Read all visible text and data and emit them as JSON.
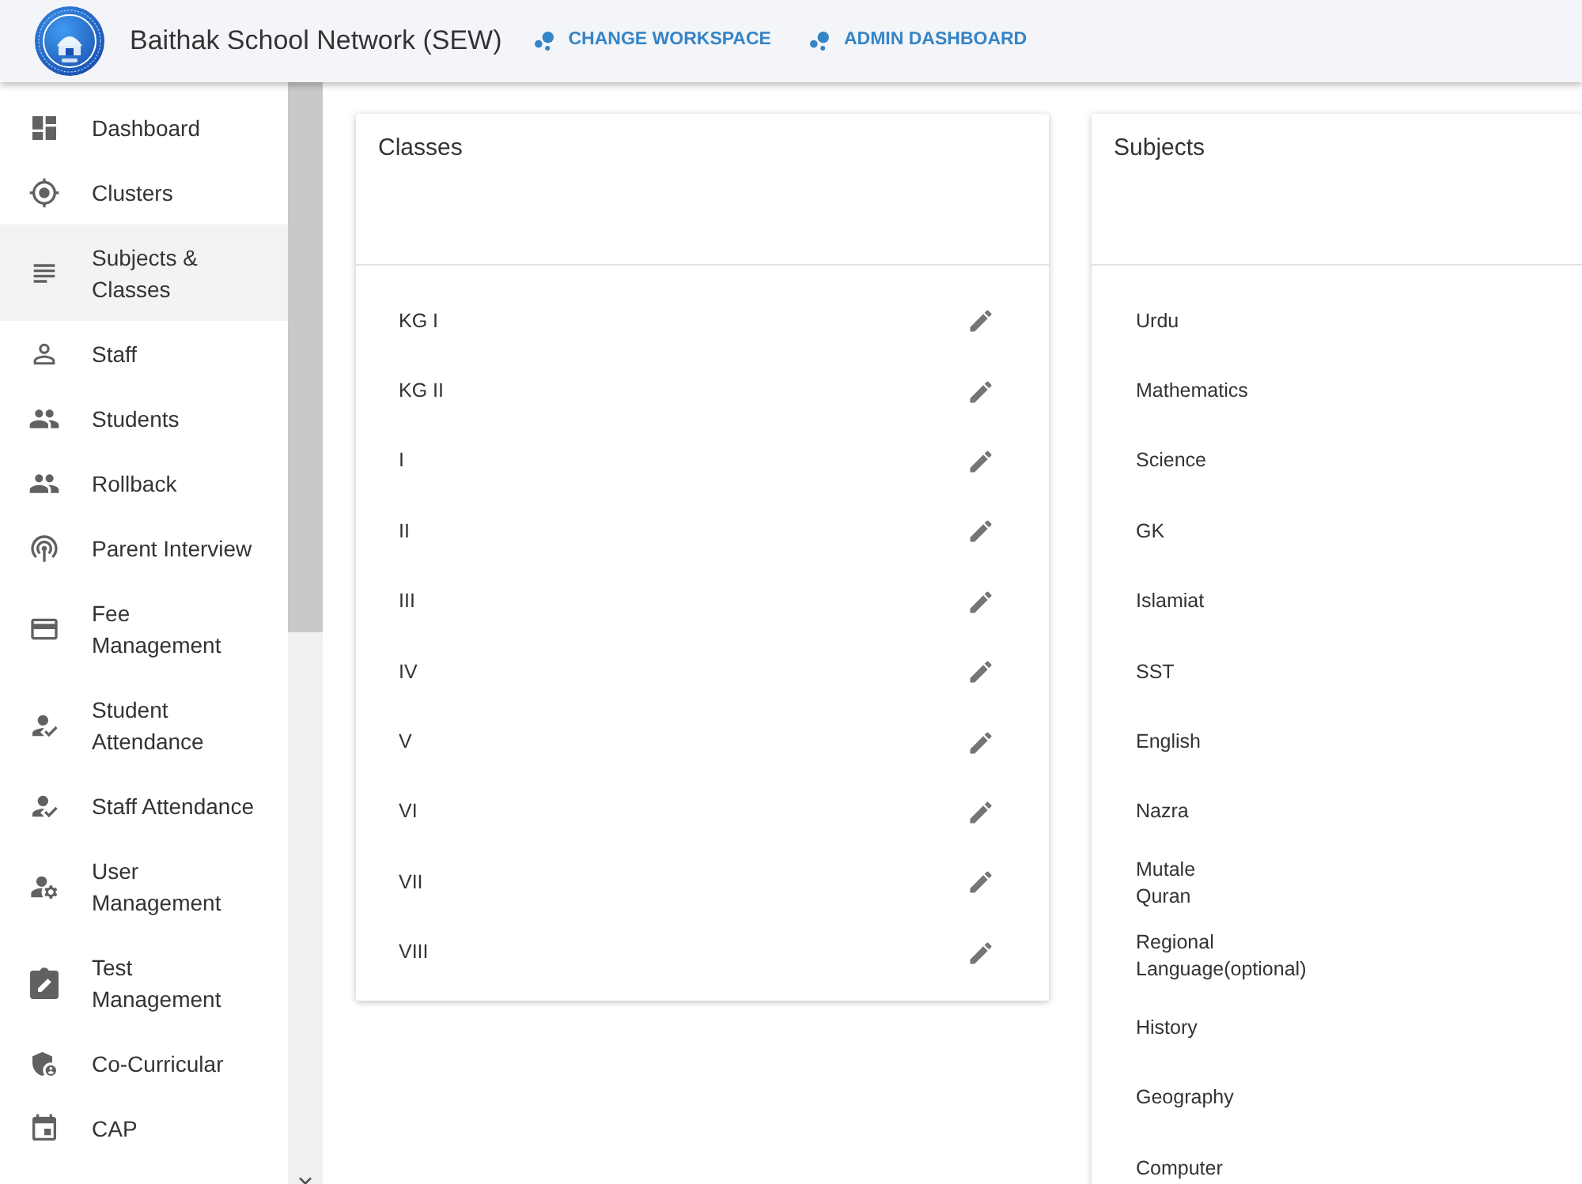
{
  "header": {
    "title": "Baithak School Network (SEW)",
    "nav_links": [
      "CHANGE WORKSPACE",
      "ADMIN DASHBOARD"
    ]
  },
  "sidebar": {
    "items": [
      {
        "label": "Dashboard",
        "selected": false
      },
      {
        "label": "Clusters",
        "selected": false
      },
      {
        "label": "Subjects & Classes",
        "selected": true
      },
      {
        "label": "Staff",
        "selected": false
      },
      {
        "label": "Students",
        "selected": false
      },
      {
        "label": "Rollback",
        "selected": false
      },
      {
        "label": "Parent Interview",
        "selected": false
      },
      {
        "label": "Fee Management",
        "selected": false
      },
      {
        "label": "Student Attendance",
        "selected": false
      },
      {
        "label": "Staff Attendance",
        "selected": false
      },
      {
        "label": "User Management",
        "selected": false
      },
      {
        "label": "Test Management",
        "selected": false
      },
      {
        "label": "Co-Curricular",
        "selected": false
      },
      {
        "label": "CAP",
        "selected": false
      }
    ]
  },
  "classes_card": {
    "title": "Classes",
    "rows": [
      "KG I",
      "KG II",
      "I",
      "II",
      "III",
      "IV",
      "V",
      "VI",
      "VII",
      "VIII"
    ]
  },
  "subjects_card": {
    "title": "Subjects",
    "rows": [
      "Urdu",
      "Mathematics",
      "Science",
      "GK",
      "Islamiat",
      "SST",
      "English",
      "Nazra",
      "Mutale Quran",
      "Regional Language(optional)",
      "History",
      "Geography",
      "Computer"
    ]
  }
}
